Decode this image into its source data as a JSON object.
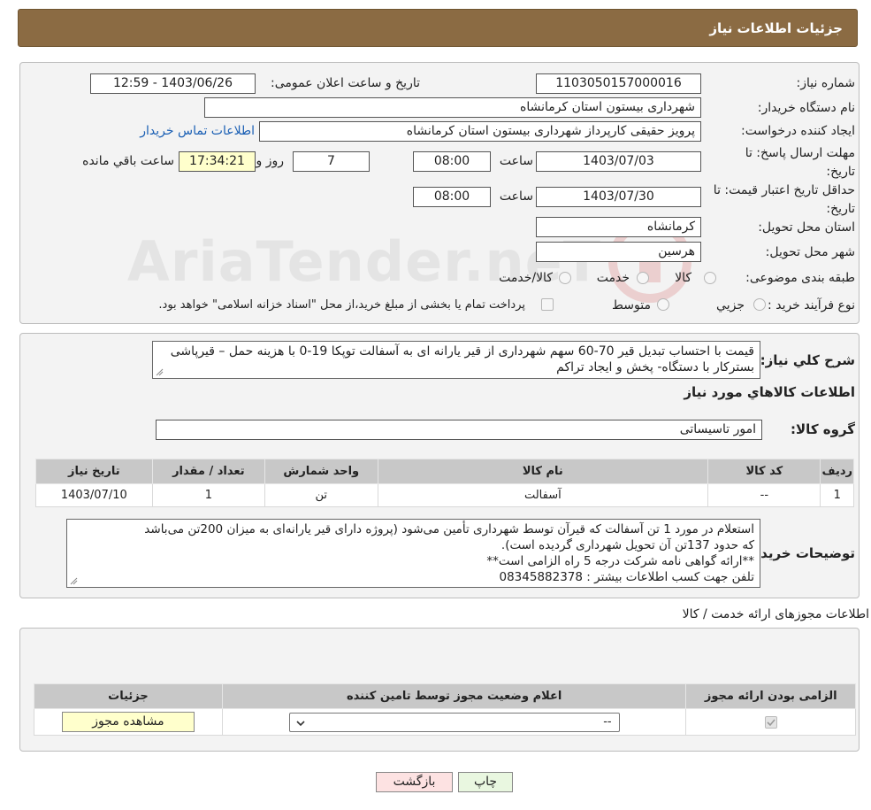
{
  "header": {
    "title": "جزئیات اطلاعات نیاز"
  },
  "form": {
    "need_number_label": "شماره نیاز:",
    "need_number": "1103050157000016",
    "announce_label": "تاریخ و ساعت اعلان عمومی:",
    "announce_value": "1403/06/26 - 12:59",
    "buyer_org_label": "نام دستگاه خریدار:",
    "buyer_org": "شهرداری بیستون استان کرمانشاه",
    "creator_label": "ایجاد کننده درخواست:",
    "creator": "پرویز حقیقی کارپرداز شهرداری بیستون استان کرمانشاه",
    "contact_link": "اطلاعات تماس خریدار",
    "deadline_label": "مهلت ارسال پاسخ: تا تاریخ:",
    "deadline_date": "1403/07/03",
    "time_label": "ساعت",
    "deadline_time": "08:00",
    "days_value": "7",
    "days_label": "روز و",
    "remaining_time": "17:34:21",
    "remaining_label": "ساعت باقي مانده",
    "validity_label": "حداقل تاریخ اعتبار قیمت: تا تاریخ:",
    "validity_date": "1403/07/30",
    "validity_time_label": "ساعت",
    "validity_time": "08:00",
    "province_label": "استان محل تحویل:",
    "province": "کرمانشاه",
    "city_label": "شهر محل تحویل:",
    "city": "هرسین",
    "category_label": "طبقه بندی موضوعی:",
    "category_options": [
      "کالا",
      "خدمت",
      "کالا/خدمت"
    ],
    "process_label": "نوع فرآیند خرید :",
    "process_options": [
      "جزيي",
      "متوسط"
    ],
    "process_note": "پرداخت تمام یا بخشی از مبلغ خرید،از محل \"اسناد خزانه اسلامی\" خواهد بود."
  },
  "summary": {
    "description_label": "شرح کلي نیاز:",
    "description": "قیمت با احتساب  تبدیل قیر 70-60  سهم شهرداری از قیر یارانه ای به آسفالت توپکا 19-0 با هزینه حمل – قیرپاشی بسترکار با دستگاه- پخش و ایجاد تراکم",
    "goods_info_title": "اطلاعات کالاهاي مورد نیاز",
    "goods_group_label": "گروه کالا:",
    "goods_group": "امور تاسیساتی"
  },
  "items_table": {
    "headers": [
      "ردیف",
      "کد کالا",
      "نام کالا",
      "واحد شمارش",
      "تعداد / مقدار",
      "تاریخ نیاز"
    ],
    "rows": [
      [
        "1",
        "--",
        "آسفالت",
        "تن",
        "1",
        "1403/07/10"
      ]
    ]
  },
  "buyer_notes": {
    "label": "توضیحات خریدار:",
    "lines": [
      "استعلام در مورد 1 تن آسفالت که قیرآن توسط شهرداری تأمین می‌شود (پروژه دارای قیر یارانه‌ای به میزان 200تن می‌باشد",
      "که حدود 137تن آن تحویل شهرداری گردیده است).",
      "**ارائه گواهی نامه شرکت درجه 5 راه الزامی است**",
      "تلفن جهت کسب اطلاعات بیشتر : 08345882378"
    ]
  },
  "licenses": {
    "title": "اطلاعات مجوزهای ارائه خدمت / کالا",
    "headers": [
      "الزامی بودن ارائه مجوز",
      "اعلام وضعیت مجوز توسط تامین کننده",
      "جزئیات"
    ],
    "select_value": "--",
    "view_button": "مشاهده مجوز"
  },
  "footer": {
    "print_button": "چاپ",
    "back_button": "بازگشت"
  },
  "watermark": {
    "text": "AriaTender.neT"
  },
  "colors": {
    "header_bg": "#8b6b43",
    "remaining_bg": "#ffffcc",
    "link": "#1a5fb4",
    "print_bg": "#e9f7e0",
    "back_bg": "#fde2e2"
  }
}
